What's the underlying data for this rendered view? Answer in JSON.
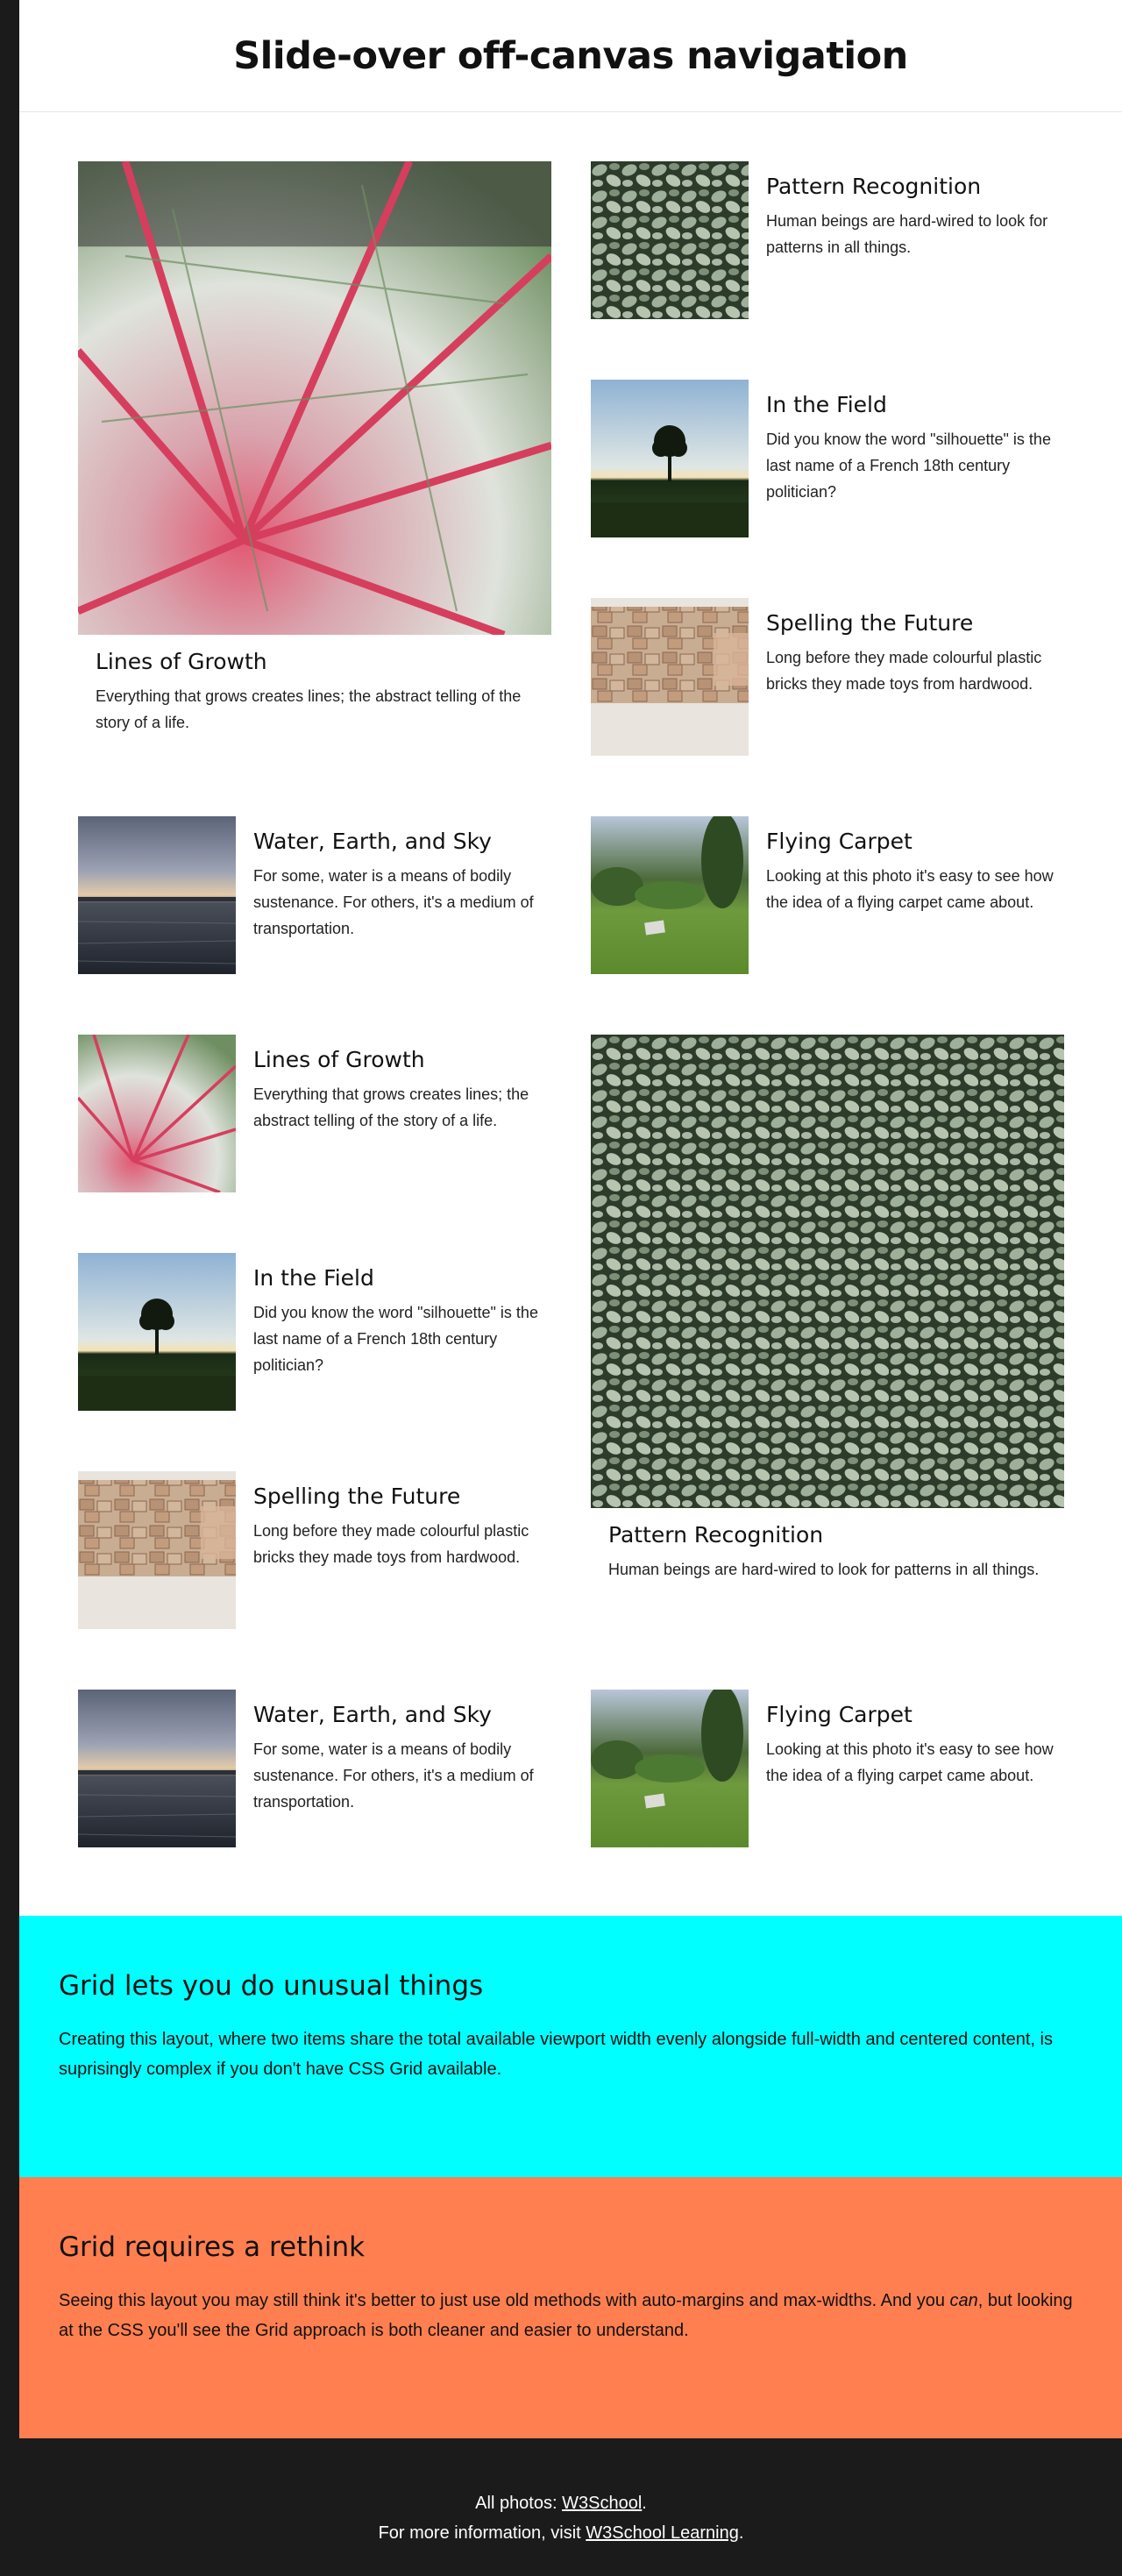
{
  "page_title": "Slide-over off-canvas navigation",
  "cards": [
    {
      "title": "Lines of Growth",
      "text": "Everything that grows creates lines; the abstract telling of the story of a life.",
      "image": "pink-veined-leaf"
    },
    {
      "title": "Pattern Recognition",
      "text": "Human beings are hard-wired to look for patterns in all things.",
      "image": "variegated-leaves"
    },
    {
      "title": "In the Field",
      "text": "Did you know the word \"silhouette\" is the last name of a French 18th century politician?",
      "image": "tree-silhouette-field"
    },
    {
      "title": "Spelling the Future",
      "text": "Long before they made colourful plastic bricks they made toys from hardwood.",
      "image": "wooden-blocks"
    },
    {
      "title": "Water, Earth, and Sky",
      "text": "For some, water is a means of bodily sustenance. For others, it's a medium of transportation.",
      "image": "lake-sunset"
    },
    {
      "title": "Flying Carpet",
      "text": "Looking at this photo it's easy to see how the idea of a flying carpet came about.",
      "image": "green-garden"
    },
    {
      "title": "Lines of Growth",
      "text": "Everything that grows creates lines; the abstract telling of the story of a life.",
      "image": "pink-veined-leaf"
    },
    {
      "title": "Pattern Recognition",
      "text": "Human beings are hard-wired to look for patterns in all things.",
      "image": "variegated-leaves"
    },
    {
      "title": "In the Field",
      "text": "Did you know the word \"silhouette\" is the last name of a French 18th century politician?",
      "image": "tree-silhouette-field"
    },
    {
      "title": "Spelling the Future",
      "text": "Long before they made colourful plastic bricks they made toys from hardwood.",
      "image": "wooden-blocks"
    },
    {
      "title": "Water, Earth, and Sky",
      "text": "For some, water is a means of bodily sustenance. For others, it's a medium of transportation.",
      "image": "lake-sunset"
    },
    {
      "title": "Flying Carpet",
      "text": "Looking at this photo it's easy to see how the idea of a flying carpet came about.",
      "image": "green-garden"
    }
  ],
  "sections": [
    {
      "heading": "Grid lets you do unusual things",
      "text": "Creating this layout, where two items share the total available viewport width evenly alongside full-width and centered content, is suprisingly complex if you don't have CSS Grid available.",
      "color": "#00ffff"
    },
    {
      "heading": "Grid requires a rethink",
      "text_before": "Seeing this layout you may still think it's better to just use old methods with auto-margins and max-widths. And you ",
      "text_em": "can",
      "text_after": ", but looking at the CSS you'll see the Grid approach is both cleaner and easier to understand.",
      "color": "#ff7f50"
    }
  ],
  "footer": {
    "line1_prefix": "All photos: ",
    "line1_link": "W3School",
    "line1_suffix": ".",
    "line2_prefix": "For more information, visit ",
    "line2_link": "W3School Learning",
    "line2_suffix": "."
  }
}
